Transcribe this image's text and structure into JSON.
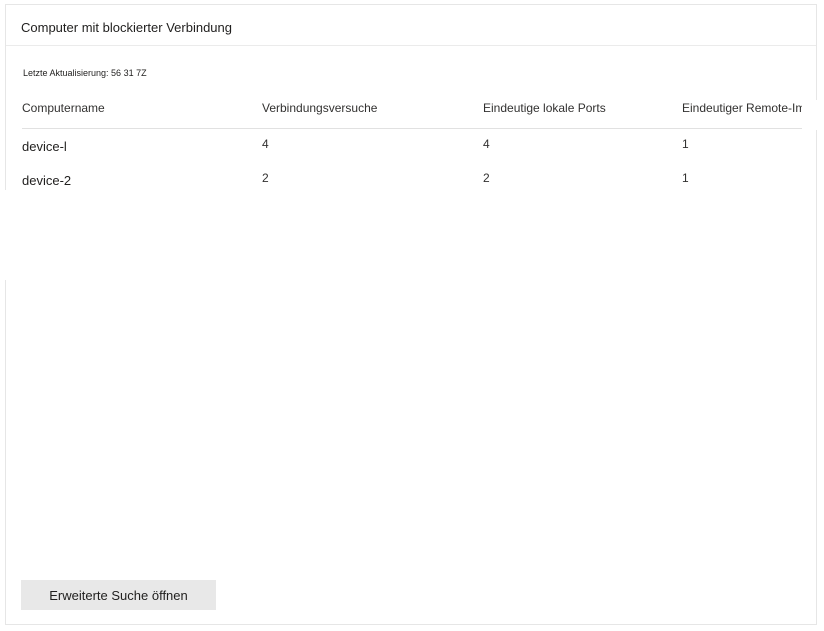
{
  "card": {
    "title": "Computer mit blockierter Verbindung",
    "last_updated": "Letzte Aktualisierung: 56 31 7Z"
  },
  "table": {
    "columns": [
      "Computername",
      "Verbindungsversuche",
      "Eindeutige lokale Ports",
      "Eindeutiger Remote-Imp"
    ],
    "rows": [
      {
        "name": "device-l",
        "attempts": "4",
        "local_ports": "4",
        "remote": "1"
      },
      {
        "name": "device-2",
        "attempts": "2",
        "local_ports": "2",
        "remote": "1"
      }
    ]
  },
  "actions": {
    "advanced_search_label": "Erweiterte Suche öffnen"
  }
}
